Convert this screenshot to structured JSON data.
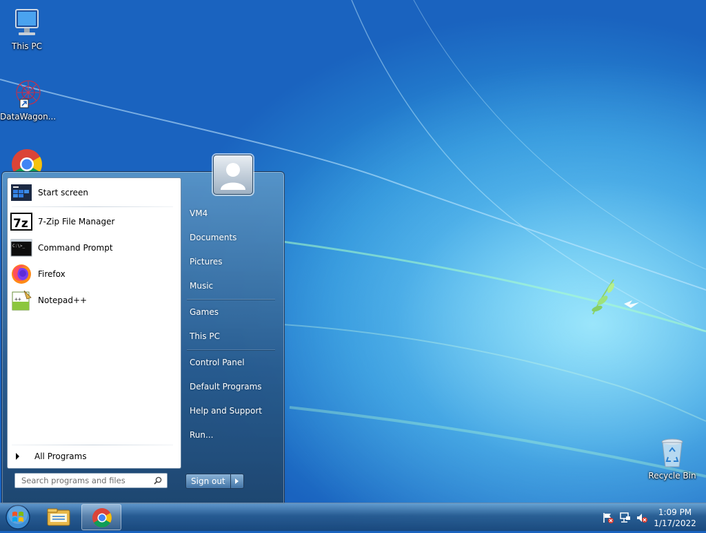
{
  "desktop": {
    "icons": [
      {
        "label": "This PC"
      },
      {
        "label": "DataWagon..."
      },
      {
        "label": "Recycle Bin"
      }
    ]
  },
  "start_menu": {
    "programs": [
      {
        "label": "Start screen",
        "icon": "start-screen-icon"
      },
      {
        "label": "7-Zip File Manager",
        "icon": "7zip-icon"
      },
      {
        "label": "Command Prompt",
        "icon": "command-prompt-icon"
      },
      {
        "label": "Firefox",
        "icon": "firefox-icon"
      },
      {
        "label": "Notepad++",
        "icon": "notepadpp-icon"
      }
    ],
    "all_programs_label": "All Programs",
    "search_placeholder": "Search programs and files",
    "right_items": [
      {
        "label": "VM4"
      },
      {
        "label": "Documents"
      },
      {
        "label": "Pictures"
      },
      {
        "label": "Music"
      },
      {
        "label": "Games"
      },
      {
        "label": "This PC"
      },
      {
        "label": "Control Panel"
      },
      {
        "label": "Default Programs"
      },
      {
        "label": "Help and Support"
      },
      {
        "label": "Run..."
      }
    ],
    "sign_out_label": "Sign out"
  },
  "taskbar": {
    "pinned": [
      "file-explorer-icon",
      "chrome-icon"
    ],
    "clock": {
      "time": "1:09 PM",
      "date": "1/17/2022"
    }
  },
  "colors": {
    "accent": "#1a63bf",
    "taskbar": "#2a5f93"
  }
}
